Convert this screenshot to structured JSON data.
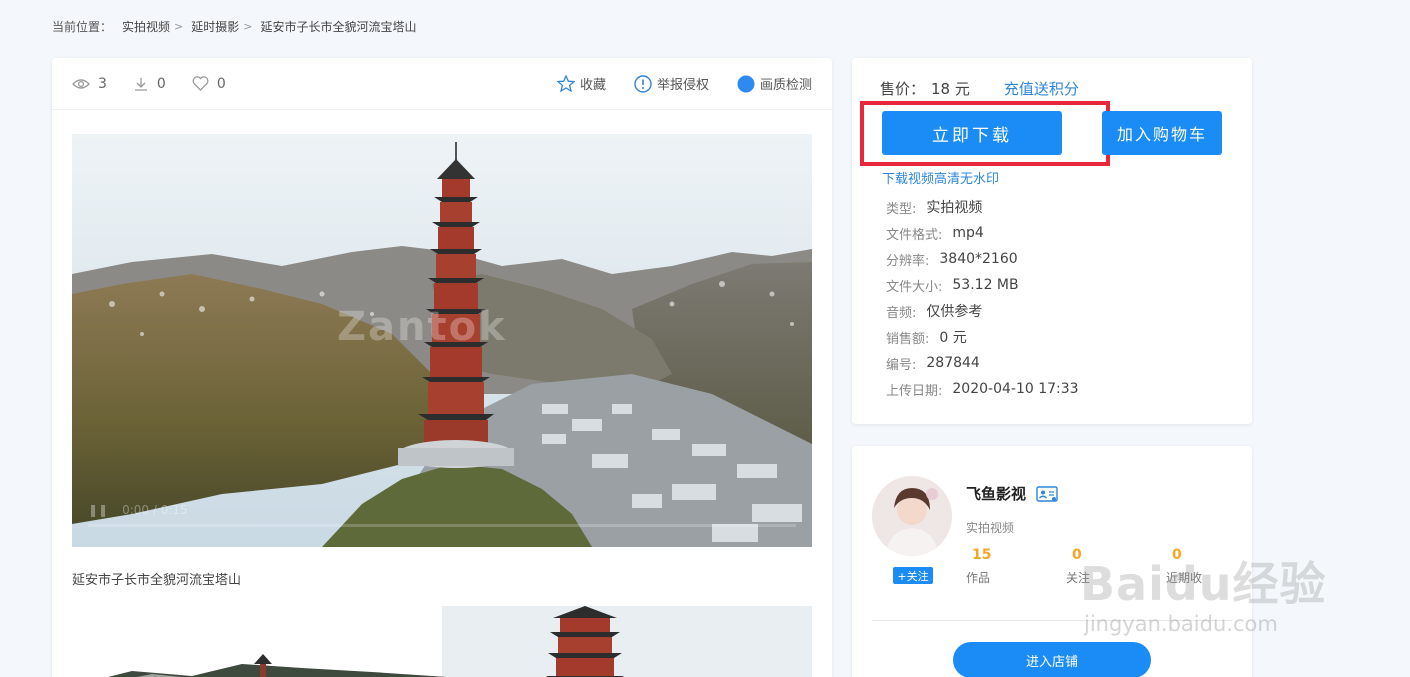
{
  "breadcrumb": {
    "label": "当前位置：",
    "items": [
      "实拍视频",
      "延时摄影",
      "延安市子长市全貌河流宝塔山"
    ],
    "sep": ">"
  },
  "stats": {
    "views": "3",
    "downloads": "0",
    "likes": "0"
  },
  "actions": {
    "favorite": "收藏",
    "report": "举报侵权",
    "quality": "画质检测"
  },
  "video": {
    "time": "0:00 / 0:15",
    "watermark": "Zantok",
    "caption": "延安市子长市全貌河流宝塔山"
  },
  "purchase": {
    "price_label": "售价：",
    "price": "18 元",
    "recharge": "充值送积分",
    "download_button": "立即下载",
    "cart_button": "加入购物车",
    "hd_link": "下载视频高清无水印"
  },
  "details": [
    {
      "key": "类型:",
      "value": "实拍视频"
    },
    {
      "key": "文件格式:",
      "value": "mp4"
    },
    {
      "key": "分辨率:",
      "value": "3840*2160"
    },
    {
      "key": "文件大小:",
      "value": "53.12 MB"
    },
    {
      "key": "音频:",
      "value": "仅供参考"
    },
    {
      "key": "销售额:",
      "value": "0 元"
    },
    {
      "key": "编号:",
      "value": "287844"
    },
    {
      "key": "上传日期:",
      "value": "2020-04-10 17:33"
    }
  ],
  "author": {
    "name": "飞鱼影视",
    "category": "实拍视频",
    "follow": "+关注",
    "stats": [
      {
        "num": "15",
        "label": "作品"
      },
      {
        "num": "0",
        "label": "关注"
      },
      {
        "num": "0",
        "label": "近期收"
      }
    ],
    "shop_button": "进入店铺"
  },
  "watermark": {
    "big": "Baidu经验",
    "small": "jingyan.baidu.com"
  },
  "colors": {
    "primary": "#1b8cf5",
    "highlight_box": "#e8283a",
    "accent_orange": "#f5a623",
    "link": "#2f86d8"
  }
}
